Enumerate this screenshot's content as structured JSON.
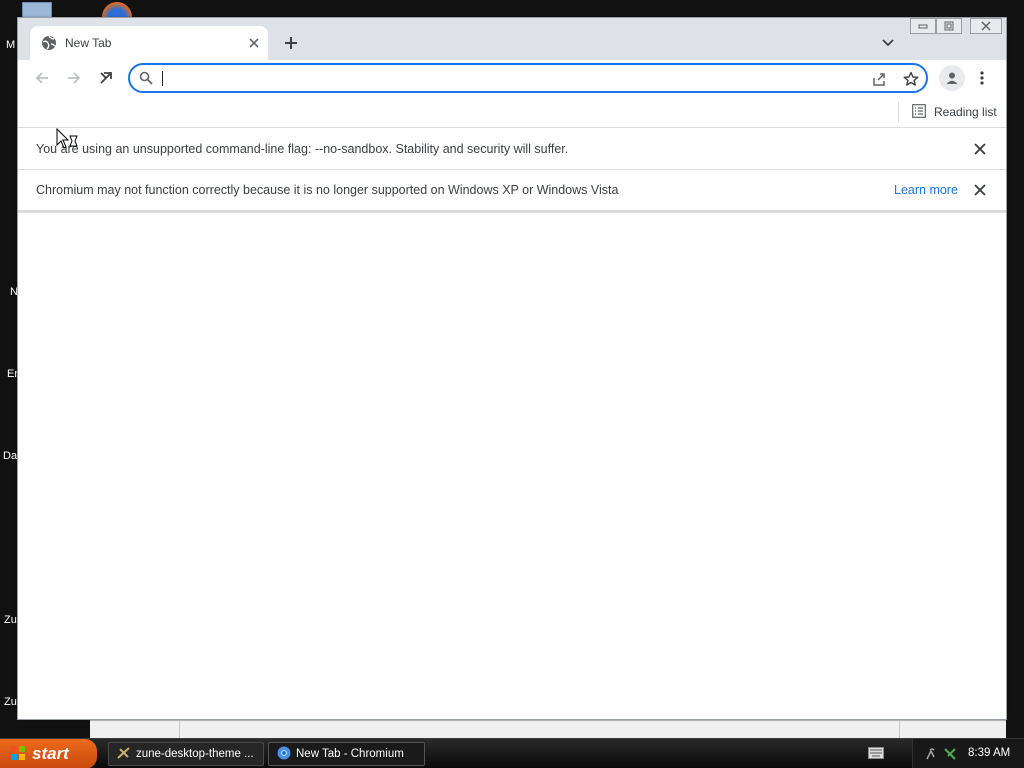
{
  "desktop": {
    "icon_labels": [
      "M",
      "N",
      "Er",
      "Da",
      "Zu",
      "Zu"
    ]
  },
  "browser": {
    "tab": {
      "title": "New Tab",
      "favicon": "globe-icon"
    },
    "toolbar": {
      "back_icon": "back-arrow-icon",
      "forward_icon": "forward-arrow-icon",
      "reload_icon": "stop-reload-icon",
      "omnibox": {
        "value": "",
        "placeholder": ""
      },
      "share_icon": "share-icon",
      "bookmark_icon": "star-icon",
      "profile_icon": "profile-icon",
      "menu_icon": "kebab-menu-icon"
    },
    "bookmark_bar": {
      "reading_list_label": "Reading list"
    },
    "infobars": [
      {
        "message": "You are using an unsupported command-line flag: --no-sandbox. Stability and security will suffer.",
        "link": ""
      },
      {
        "message": "Chromium may not function correctly because it is no longer supported on Windows XP or Windows Vista",
        "link": "Learn more"
      }
    ],
    "accent_color": "#1a73e8"
  },
  "taskbar": {
    "start_label": "start",
    "tasks": [
      {
        "label": "zune-desktop-theme ...",
        "icon": "folder-tools-icon",
        "active": false
      },
      {
        "label": "New Tab - Chromium",
        "icon": "chromium-icon",
        "active": true
      }
    ],
    "clock": "8:39 AM"
  }
}
